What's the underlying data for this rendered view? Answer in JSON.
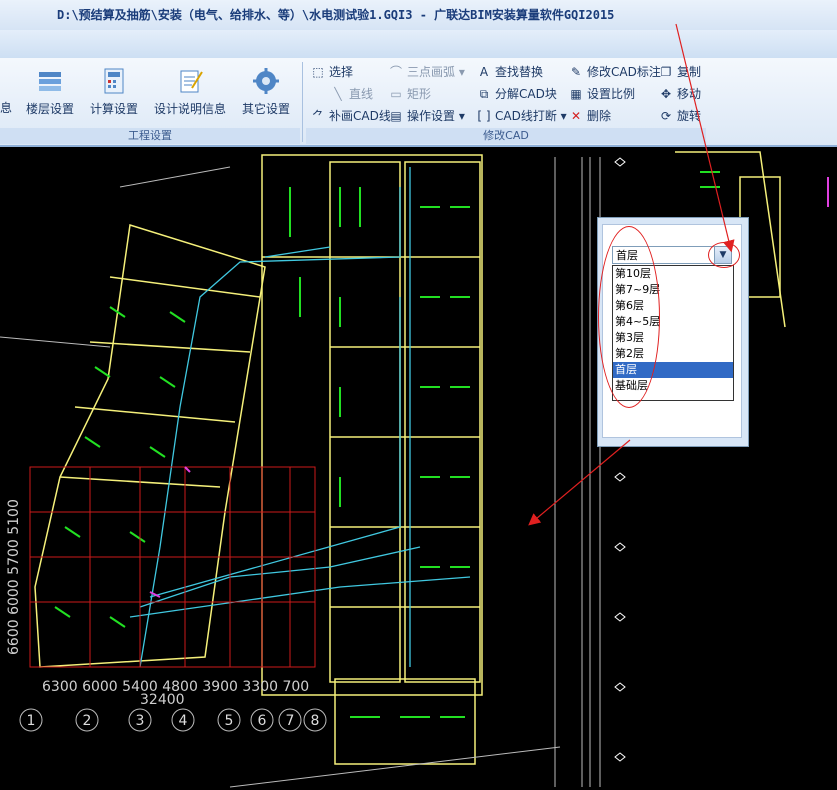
{
  "window": {
    "title": "D:\\预结算及抽筋\\安装（电气、给排水、等）\\水电测试验1.GQI3 - 广联达BIM安装算量软件GQI2015"
  },
  "ribbon": {
    "groups": [
      {
        "caption": "工程设置"
      },
      {
        "caption": "修改CAD"
      }
    ],
    "cut_label": "息",
    "big_buttons": [
      {
        "label": "楼层设置",
        "icon": "floor-settings-icon"
      },
      {
        "label": "计算设置",
        "icon": "calc-settings-icon"
      },
      {
        "label": "设计说明信息",
        "icon": "design-notes-icon"
      },
      {
        "label": "其它设置",
        "icon": "other-settings-gear-icon"
      }
    ],
    "cad_tools": {
      "select": "选择",
      "line": "直线",
      "draw_cad_line": "补画CAD线",
      "three_point_arc": "三点画弧",
      "rectangle": "矩形",
      "operation_settings": "操作设置",
      "find_replace": "查找替换",
      "explode_cad_block": "分解CAD块",
      "cad_line_break": "CAD线打断",
      "modify_cad_annotation": "修改CAD标注",
      "set_scale": "设置比例",
      "delete": "删除",
      "copy": "复制",
      "move": "移动",
      "rotate": "旋转"
    }
  },
  "floor_selector": {
    "selected": "首层",
    "options": [
      "第10层",
      "第7~9层",
      "第6层",
      "第4~5层",
      "第3层",
      "第2层",
      "首层",
      "基础层"
    ]
  },
  "cad_labels": {
    "dims_bottom": "6300 6000 5400 4800 3900 3300 700",
    "dim_sub": "32400",
    "dims_left": "6600 6000 5700 5100",
    "axis_numbers": [
      "1",
      "2",
      "3",
      "4",
      "5",
      "6",
      "7",
      "8"
    ]
  },
  "colors": {
    "accent": "#316ac5",
    "annotation": "#e02020",
    "cad_yellow": "#f5f07a",
    "cad_green": "#22e022",
    "cad_cyan": "#40c8e0"
  }
}
